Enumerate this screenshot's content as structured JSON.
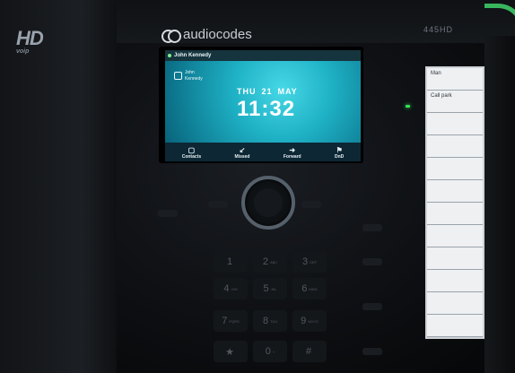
{
  "device": {
    "hd_logo": "HD",
    "hd_logo_sub": "voip",
    "brand": "audiocodes",
    "model": "445HD"
  },
  "screen": {
    "header_name": "John Kennedy",
    "line_label_1": "John",
    "line_label_2": "Kennedy",
    "day": "THU",
    "date": "21",
    "month": "MAY",
    "time": "11:32",
    "softkeys": [
      {
        "label": "Contacts",
        "icon": "contacts-icon",
        "glyph": "▢"
      },
      {
        "label": "Missed",
        "icon": "missed-call-icon",
        "glyph": "↙"
      },
      {
        "label": "Forward",
        "icon": "forward-icon",
        "glyph": "➜"
      },
      {
        "label": "DnD",
        "icon": "dnd-flag-icon",
        "glyph": "⚑"
      }
    ],
    "colors": {
      "accent": "#1fb2c6",
      "header": "#16343d",
      "softbar": "#0d2735"
    }
  },
  "keypad": [
    {
      "digit": "1",
      "letters": ""
    },
    {
      "digit": "2",
      "letters": "ABC"
    },
    {
      "digit": "3",
      "letters": "DEF"
    },
    {
      "digit": "4",
      "letters": "GHI"
    },
    {
      "digit": "5",
      "letters": "JKL"
    },
    {
      "digit": "6",
      "letters": "MNO"
    },
    {
      "digit": "7",
      "letters": "PQRS"
    },
    {
      "digit": "8",
      "letters": "TUV"
    },
    {
      "digit": "9",
      "letters": "WXYZ"
    },
    {
      "digit": "★",
      "letters": ""
    },
    {
      "digit": "0",
      "letters": "+"
    },
    {
      "digit": "#",
      "letters": ""
    }
  ],
  "bls_panel": {
    "rows": [
      "Man",
      "Call park",
      "",
      "",
      "",
      "",
      "",
      "",
      "",
      "",
      "",
      ""
    ]
  }
}
